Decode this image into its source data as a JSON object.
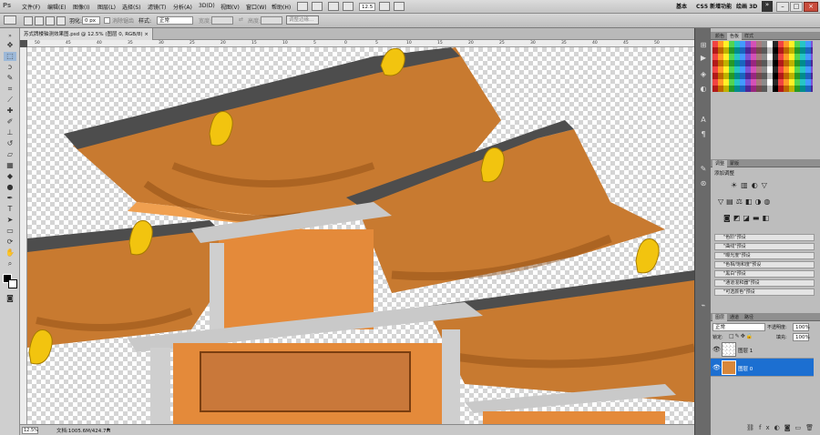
{
  "app": {
    "logo": "Ps"
  },
  "menu": [
    "文件(F)",
    "编辑(E)",
    "图像(I)",
    "图层(L)",
    "选择(S)",
    "滤镜(T)",
    "分析(A)",
    "3D(D)",
    "视图(V)",
    "窗口(W)",
    "帮助(H)"
  ],
  "zoom_field": "12.5",
  "workspace": {
    "basic": "基本",
    "cs_new": "CS5 新增功能",
    "d3": "绘画 3D"
  },
  "options": {
    "feather_label": "羽化:",
    "feather_value": "0 px",
    "antialias": "消除锯齿",
    "style_label": "样式:",
    "style_value": "正常",
    "width_label": "宽度:",
    "height_label": "高度:",
    "refine_button": "调整边缘..."
  },
  "document": {
    "tab_title": "苏式牌楼轴测效果图.psd @ 12.5% (图层 0, RGB/8)"
  },
  "ruler_ticks": [
    "50",
    "45",
    "40",
    "35",
    "30",
    "25",
    "20",
    "15",
    "10",
    "5",
    "0",
    "5",
    "10",
    "15",
    "20",
    "25",
    "30",
    "35",
    "40",
    "45",
    "50"
  ],
  "status": {
    "zoom": "12.5%",
    "doc_size": "文档:1005.6M/424.7M"
  },
  "panels": {
    "color_tabs": [
      "颜色",
      "色板",
      "样式"
    ],
    "adjust_title": "添加调整",
    "adjust_tabs": [
      "调整",
      "蒙版"
    ],
    "presets": [
      "\"色阶\"预设",
      "\"曲线\"预设",
      "\"曝光度\"预设",
      "\"色相/饱和度\"预设",
      "\"黑白\"预设",
      "\"通道混和器\"预设",
      "\"可选颜色\"预设"
    ],
    "layers_tabs": [
      "图层",
      "通道",
      "路径"
    ],
    "blend_mode": "正常",
    "opacity_label": "不透明度:",
    "opacity_value": "100%",
    "lock_label": "锁定:",
    "fill_label": "填充:",
    "fill_value": "100%",
    "layers": [
      {
        "name": "图层 1",
        "selected": false
      },
      {
        "name": "图层 0",
        "selected": true
      }
    ]
  },
  "colors": {
    "accent": "#1c6fd1",
    "roof_orange": "#d8873a",
    "roof_dark": "#4a4a4a",
    "gold": "#f2c40f"
  }
}
